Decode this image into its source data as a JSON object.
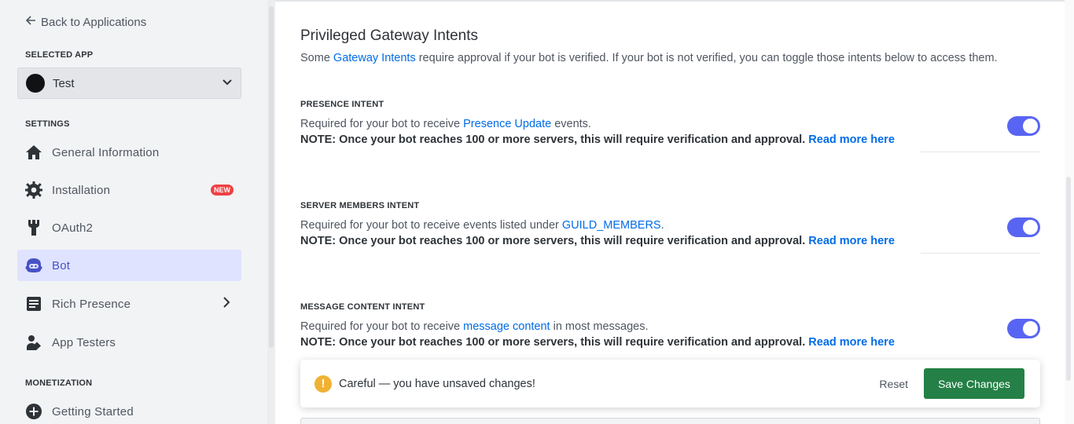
{
  "sidebar": {
    "back_label": "Back to Applications",
    "selected_app_heading": "SELECTED APP",
    "selected_app_name": "Test",
    "settings_heading": "SETTINGS",
    "items": [
      {
        "label": "General Information",
        "icon": "home-icon"
      },
      {
        "label": "Installation",
        "icon": "gear-icon",
        "badge": "NEW"
      },
      {
        "label": "OAuth2",
        "icon": "wrench-icon"
      },
      {
        "label": "Bot",
        "icon": "bot-icon",
        "active": true
      },
      {
        "label": "Rich Presence",
        "icon": "document-icon"
      },
      {
        "label": "App Testers",
        "icon": "user-icon"
      }
    ],
    "monetization_heading": "MONETIZATION",
    "monetization_items": [
      {
        "label": "Getting Started",
        "icon": "plus-circle-icon"
      }
    ]
  },
  "main": {
    "title": "Privileged Gateway Intents",
    "desc_prefix": "Some ",
    "desc_link": "Gateway Intents",
    "desc_suffix": " require approval if your bot is verified. If your bot is not verified, you can toggle those intents below to access them.",
    "intents": [
      {
        "label": "PRESENCE INTENT",
        "desc_prefix": "Required for your bot to receive ",
        "desc_link": "Presence Update",
        "desc_suffix": " events.",
        "note": "NOTE: Once your bot reaches 100 or more servers, this will require verification and approval.",
        "read_more": "Read more here",
        "enabled": true
      },
      {
        "label": "SERVER MEMBERS INTENT",
        "desc_prefix": "Required for your bot to receive events listed under ",
        "desc_link": "GUILD_MEMBERS",
        "desc_suffix": ".",
        "note": "NOTE: Once your bot reaches 100 or more servers, this will require verification and approval.",
        "read_more": "Read more here",
        "enabled": true
      },
      {
        "label": "MESSAGE CONTENT INTENT",
        "desc_prefix": "Required for your bot to receive ",
        "desc_link": "message content",
        "desc_suffix": " in most messages.",
        "note": "NOTE: Once your bot reaches 100 or more servers, this will require verification and approval.",
        "read_more": "Read more here",
        "enabled": true
      }
    ]
  },
  "save_bar": {
    "message": "Careful — you have unsaved changes!",
    "warn_glyph": "!",
    "reset_label": "Reset",
    "save_label": "Save Changes"
  },
  "colors": {
    "accent": "#5865f2",
    "link": "#006ce7",
    "save_button": "#248046",
    "warning": "#f0b232",
    "badge": "#ed4245",
    "active_nav_bg": "#e0e3ff"
  }
}
